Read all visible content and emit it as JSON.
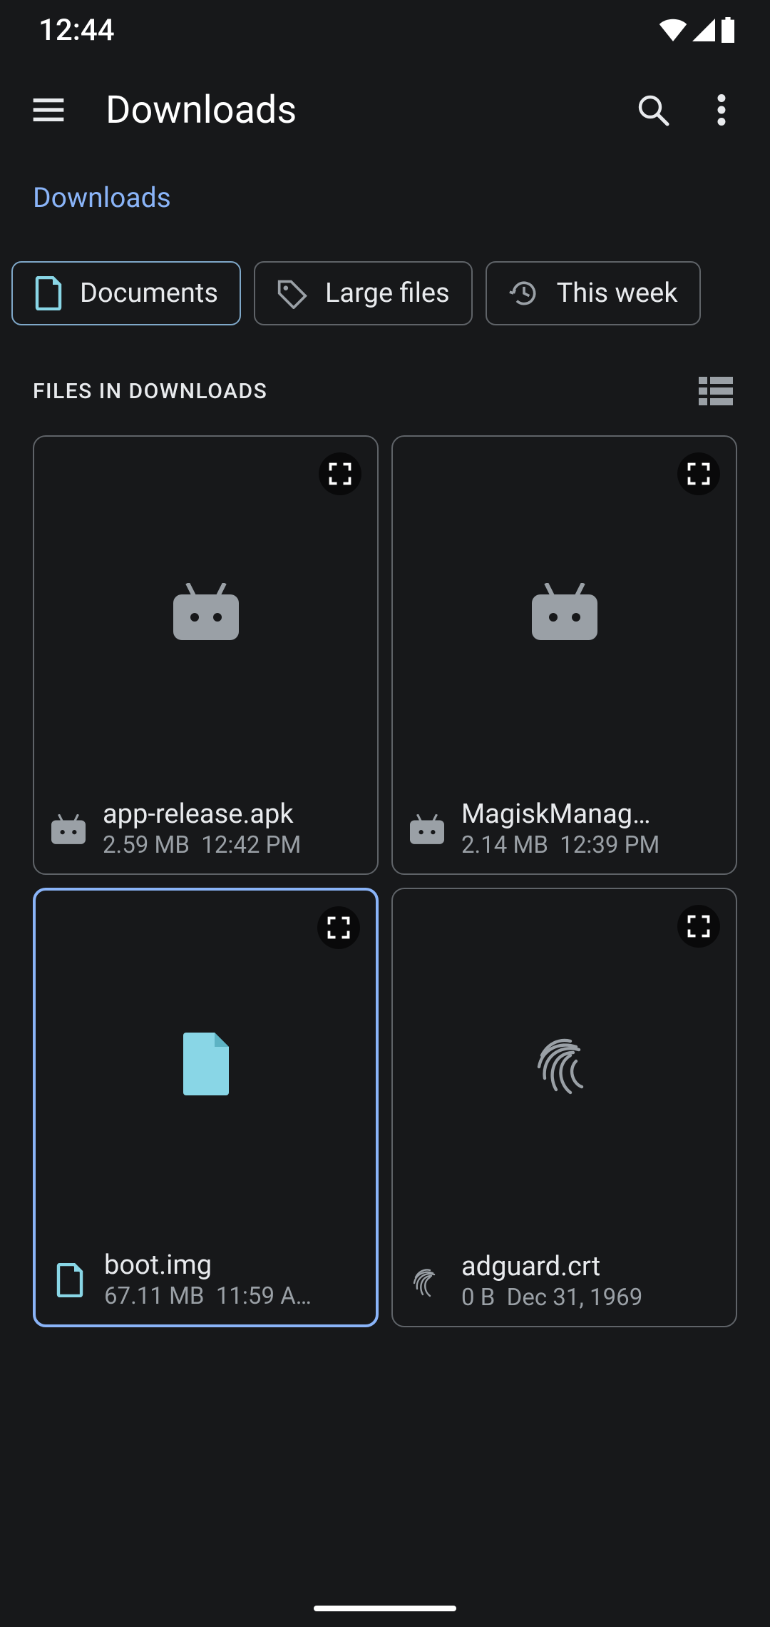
{
  "status": {
    "time": "12:44"
  },
  "appbar": {
    "title": "Downloads"
  },
  "breadcrumb": "Downloads",
  "chips": [
    {
      "label": "Documents",
      "icon": "document",
      "active": true
    },
    {
      "label": "Large files",
      "icon": "tag",
      "active": false
    },
    {
      "label": "This week",
      "icon": "history",
      "active": false
    }
  ],
  "section": {
    "label": "FILES IN DOWNLOADS"
  },
  "files": [
    {
      "name": "app-release.apk",
      "size": "2.59 MB",
      "time": "12:42 PM",
      "type": "apk",
      "selected": false
    },
    {
      "name": "MagiskManag…",
      "size": "2.14 MB",
      "time": "12:39 PM",
      "type": "apk",
      "selected": false
    },
    {
      "name": "boot.img",
      "size": "67.11 MB",
      "time": "11:59 A…",
      "type": "file",
      "selected": true
    },
    {
      "name": "adguard.crt",
      "size": "0 B",
      "time": "Dec 31, 1969",
      "type": "cert",
      "selected": false
    }
  ]
}
